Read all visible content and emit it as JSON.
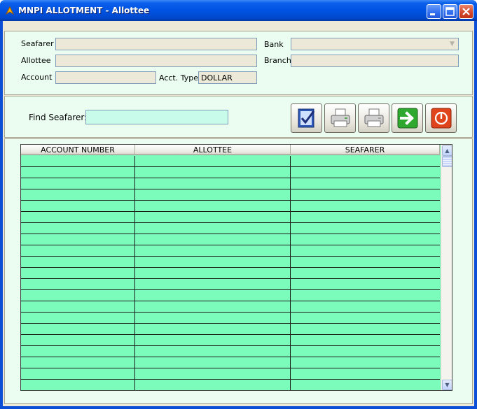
{
  "window": {
    "title": "MNPI ALLOTMENT - Allottee"
  },
  "details": {
    "seafarer_label": "Seafarer",
    "allottee_label": "Allottee",
    "account_label": "Account",
    "acct_type_label": "Acct. Type",
    "acct_type_value": "DOLLAR",
    "bank_label": "Bank",
    "branch_label": "Branch"
  },
  "search": {
    "find_label": "Find Seafarer:",
    "find_value": ""
  },
  "toolbar": {
    "icons": [
      "checklist-icon",
      "printer-icon",
      "printer-icon",
      "arrow-right-icon",
      "power-icon"
    ]
  },
  "grid": {
    "columns": [
      "ACCOUNT NUMBER",
      "ALLOTTEE",
      "SEAFARER"
    ],
    "rows": []
  },
  "colors": {
    "row_fill": "#7cfcba",
    "panel_bg": "#eafdf0",
    "titlebar": "#0054e3"
  }
}
